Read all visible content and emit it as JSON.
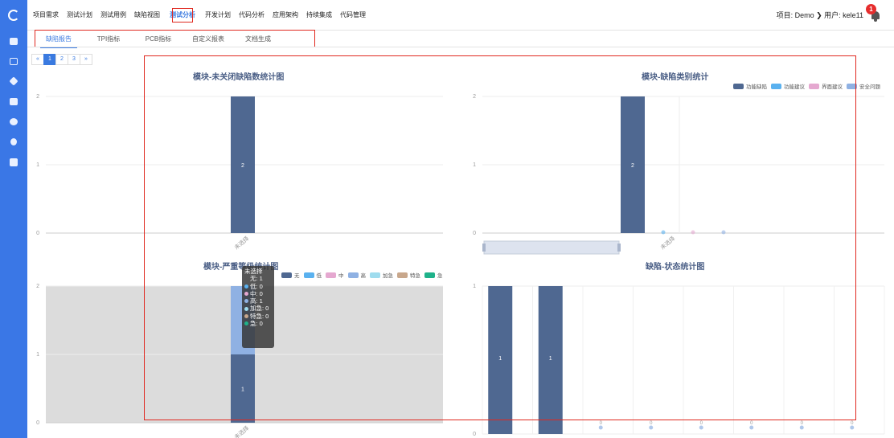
{
  "nav": {
    "items": [
      "项目需求",
      "测试计划",
      "测试用例",
      "缺陷视图",
      "测试分析",
      "开发计划",
      "代码分析",
      "应用架构",
      "持续集成",
      "代码管理"
    ],
    "active_index": 4
  },
  "header": {
    "project_user": "项目: Demo ❯ 用户: kele11",
    "badge": "1"
  },
  "subtabs": {
    "items": [
      "缺陷报告",
      "TPI指标",
      "PCB指标",
      "自定义报表",
      "文档生成"
    ],
    "active_index": 0
  },
  "pager": {
    "prev": "«",
    "pages": [
      "1",
      "2",
      "3"
    ],
    "next": "»",
    "current": "1"
  },
  "colors": {
    "sidebar": "#3a77e6",
    "accent": "#3a7ae0",
    "highlight": "#e0281f",
    "bar": "#4f6891"
  },
  "tooltip": {
    "title": "未选择",
    "rows": [
      {
        "label": "无: 1",
        "color": ""
      },
      {
        "label": "低: 0",
        "color": "#5ab1ef"
      },
      {
        "label": "中: 0",
        "color": "#e5a8d0"
      },
      {
        "label": "高: 1",
        "color": "#8fb1e3"
      },
      {
        "label": "加急: 0",
        "color": "#9fdcee"
      },
      {
        "label": "特急: 0",
        "color": "#c8a78c"
      },
      {
        "label": "急: 0",
        "color": "#1fb28a"
      }
    ]
  },
  "chart_data": [
    {
      "type": "bar",
      "title": "模块-未关闭缺陷数统计图",
      "categories": [
        "未选择"
      ],
      "values": [
        2
      ],
      "ylim": [
        0,
        2
      ],
      "yticks": [
        "0",
        "1",
        "2"
      ],
      "data_labels": [
        "2"
      ]
    },
    {
      "type": "bar",
      "title": "模块-缺陷类别统计",
      "categories": [
        "未选择"
      ],
      "series": [
        {
          "name": "功能缺陷",
          "values": [
            2
          ],
          "color": "#4f6891"
        },
        {
          "name": "功能建议",
          "values": [
            0
          ],
          "color": "#5ab1ef"
        },
        {
          "name": "界面建议",
          "values": [
            0
          ],
          "color": "#e5a8d0"
        },
        {
          "name": "安全问题",
          "values": [
            0
          ],
          "color": "#8fb1e3"
        }
      ],
      "ylim": [
        0,
        2
      ],
      "yticks": [
        "0",
        "1",
        "2"
      ],
      "data_labels": [
        "2"
      ],
      "legend": "top-right"
    },
    {
      "type": "bar",
      "title": "模块-严重等级统计图",
      "categories": [
        "未选择"
      ],
      "series": [
        {
          "name": "无",
          "values": [
            1
          ],
          "color": "#4f6891"
        },
        {
          "name": "低",
          "values": [
            0
          ],
          "color": "#5ab1ef"
        },
        {
          "name": "中",
          "values": [
            0
          ],
          "color": "#e5a8d0"
        },
        {
          "name": "高",
          "values": [
            1
          ],
          "color": "#8fb1e3"
        },
        {
          "name": "加急",
          "values": [
            0
          ],
          "color": "#9fdcee"
        },
        {
          "name": "特急",
          "values": [
            0
          ],
          "color": "#c8a78c"
        },
        {
          "name": "急",
          "values": [
            0
          ],
          "color": "#1fb28a"
        }
      ],
      "stacked": true,
      "ylim": [
        0,
        2
      ],
      "yticks": [
        "0",
        "1",
        "2"
      ],
      "data_labels": [
        "1"
      ],
      "legend": "top"
    },
    {
      "type": "bar",
      "title": "缺陷-状态统计图",
      "categories": [
        "",
        "",
        "",
        "",
        "",
        "",
        "",
        ""
      ],
      "values": [
        1,
        1,
        0,
        0,
        0,
        0,
        0,
        0
      ],
      "ylim": [
        0,
        1
      ],
      "yticks": [
        "0",
        "1"
      ],
      "data_labels": [
        "1",
        "1",
        "0",
        "0",
        "0",
        "0",
        "0",
        "0"
      ]
    }
  ]
}
